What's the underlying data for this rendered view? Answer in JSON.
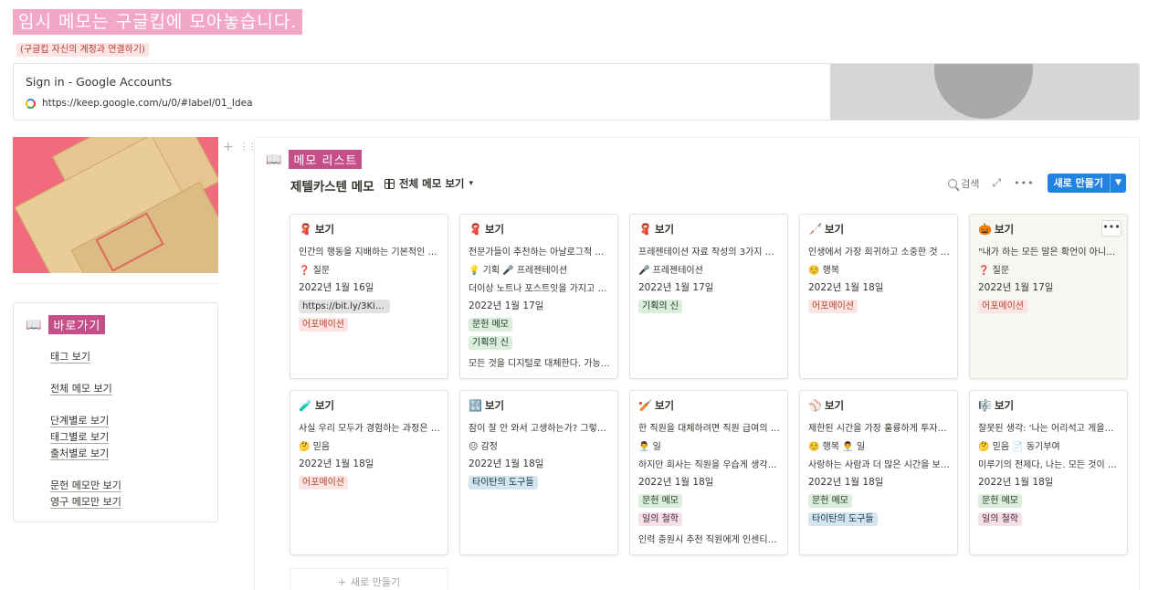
{
  "header": {
    "title": "임시 메모는 구글킵에 모아놓습니다.",
    "subtitle": "(구글킵 자신의 계정과 연결하기)"
  },
  "bookmark": {
    "title": "Sign in - Google Accounts",
    "url": "https://keep.google.com/u/0/#label/01_Idea"
  },
  "sidebar": {
    "icon": "📖",
    "heading": "바로가기",
    "links": [
      "태그 보기",
      "전체 메모 보기",
      "단계별로 보기",
      "태그별로 보기",
      "출처별로 보기",
      "문헌 메모만 보기",
      "영구 메모만 보기"
    ]
  },
  "database": {
    "icon": "📖",
    "heading": "메모 리스트",
    "title": "제텔카스텐 메모",
    "view_label": "전체 메모 보기",
    "search_label": "검색",
    "new_button_label": "새로 만들기",
    "add_card_label": "새로 만들기",
    "more_label": "•••",
    "cards": [
      {
        "icon": "🧣",
        "title": "보기",
        "lines": [
          {
            "text": "인간의 행동을 지배하는 기본적인 힘..."
          },
          {
            "text": "❓ 질문"
          }
        ],
        "date": "2022년 1월 16일",
        "tags": [
          {
            "label": "https://bit.ly/3Ki9...",
            "color": "gray"
          },
          {
            "label": "어포메이션",
            "color": "red"
          }
        ]
      },
      {
        "icon": "🧣",
        "title": "보기",
        "lines": [
          {
            "text": "전문가들이 추천하는 아날로그적 작업..."
          },
          {
            "text": "💡 기획  🎤 프레젠테이션"
          },
          {
            "text": "더이상 노트나 포스트잇을 가지고 다..."
          }
        ],
        "date": "2022년 1월 17일",
        "tags": [
          {
            "label": "문헌 메모",
            "color": "green"
          },
          {
            "label": "기획의 신",
            "color": "green"
          }
        ],
        "footer": "모든 것을 디지털로 대체한다. 가능할..."
      },
      {
        "icon": "🧣",
        "title": "보기",
        "lines": [
          {
            "text": "프레젠테이션 자료 작성의 3가지 원..."
          },
          {
            "text": "🎤 프레젠테이션"
          }
        ],
        "date": "2022년 1월 17일",
        "tags": [
          {
            "label": "기획의 신",
            "color": "green"
          }
        ]
      },
      {
        "icon": "🦯",
        "title": "보기",
        "lines": [
          {
            "text": "인생에서 가장 희귀하고 소중한 것 대..."
          },
          {
            "text": "☺️ 행복"
          }
        ],
        "date": "2022년 1월 18일",
        "tags": [
          {
            "label": "어포메이션",
            "color": "red"
          }
        ]
      },
      {
        "icon": "🎃",
        "title": "보기",
        "lines": [
          {
            "text": "\"내가 하는 모든 말은 확언이 아니라 ..."
          },
          {
            "text": "❓ 질문"
          }
        ],
        "date": "2022년 1월 17일",
        "tags": [
          {
            "label": "어포메이션",
            "color": "red"
          }
        ],
        "hovered": true
      },
      {
        "icon": "🧪",
        "title": "보기",
        "lines": [
          {
            "text": "사실 우리 모두가 경험하는 과정은 이..."
          },
          {
            "text": "🤔 믿음"
          }
        ],
        "date": "2022년 1월 18일",
        "tags": [
          {
            "label": "어포메이션",
            "color": "red"
          }
        ]
      },
      {
        "icon": "🔣",
        "title": "보기",
        "lines": [
          {
            "text": "잠이 잘 안 와서 고생하는가? 그렇다..."
          },
          {
            "text": "😐 감정"
          }
        ],
        "date": "2022년 1월 18일",
        "tags": [
          {
            "label": "타이탄의 도구들",
            "color": "blue"
          }
        ]
      },
      {
        "icon": "🏏",
        "title": "보기",
        "lines": [
          {
            "text": "한 직원을 대체하려면 직원 급여의 2..."
          },
          {
            "text": "👨‍💼 일"
          },
          {
            "text": "하지만 회사는 직원을 우습게 생각한..."
          }
        ],
        "date": "2022년 1월 18일",
        "tags": [
          {
            "label": "문헌 메모",
            "color": "green"
          },
          {
            "label": "일의 철학",
            "color": "pink"
          }
        ],
        "footer": "인력 충원시 추천 직원에게 인센티브..."
      },
      {
        "icon": "⚾",
        "title": "보기",
        "lines": [
          {
            "text": "제한된 시간을 가장 훌륭하게 투자하..."
          },
          {
            "text": "☺️ 행복  👨‍💼 일"
          },
          {
            "text": "사랑하는 사람과 더 많은 시간을 보내..."
          }
        ],
        "date": "2022년 1월 18일",
        "tags": [
          {
            "label": "문헌 메모",
            "color": "green"
          },
          {
            "label": "타이탄의 도구들",
            "color": "blue"
          }
        ]
      },
      {
        "icon": "🎼",
        "title": "보기",
        "lines": [
          {
            "text": "잘못된 생각: '나는 어리석고 게을러' ..."
          },
          {
            "text": "🤔 믿음  📄 동기부여"
          },
          {
            "text": "미루기의 전제다, 나는. 모든 것이 완..."
          }
        ],
        "date": "2022년 1월 18일",
        "tags": [
          {
            "label": "문헌 메모",
            "color": "green"
          },
          {
            "label": "일의 철학",
            "color": "pink"
          }
        ]
      }
    ]
  }
}
